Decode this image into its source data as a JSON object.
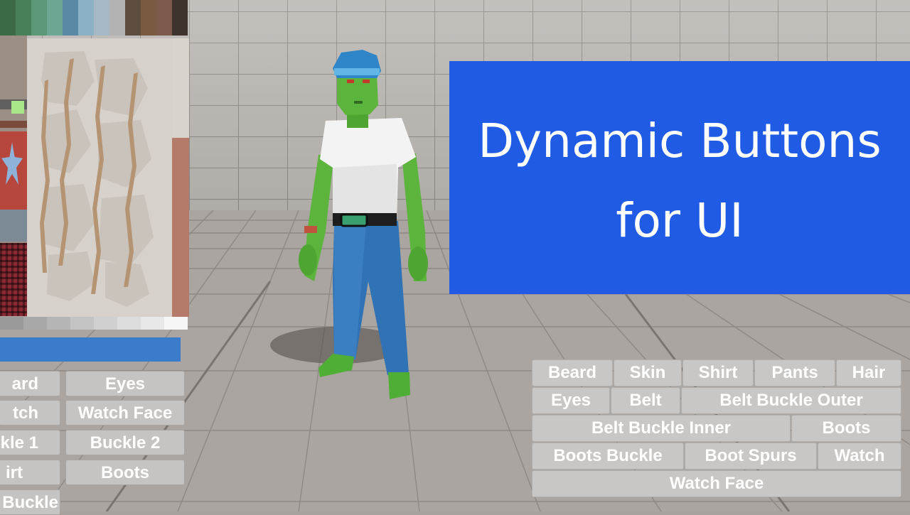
{
  "banner": {
    "line1": "Dynamic Buttons",
    "line2": "for UI"
  },
  "left_panel": {
    "button_rows": [
      {
        "left": "ard",
        "right": "Eyes"
      },
      {
        "left": "tch",
        "right": "Watch Face"
      },
      {
        "left": "kle 1",
        "right": "Buckle 2"
      },
      {
        "left": "irt",
        "right": "Boots"
      },
      {
        "left": "Buckle",
        "right": ""
      }
    ],
    "swatch_colors": [
      "#3d6a46",
      "#47805a",
      "#5a9878",
      "#6ba792",
      "#5a89a6",
      "#8ab2c4",
      "#a6b8c4",
      "#b3b3b3",
      "#5c4d3f",
      "#7a5a40",
      "#7d5a4c",
      "#3f342d"
    ],
    "gray_strip": [
      "#9a9a9a",
      "#a8a8a8",
      "#b5b5b5",
      "#c3c3c3",
      "#d0d0d0",
      "#dcdcdc",
      "#e8e8e8",
      "#f6f6f6"
    ]
  },
  "button_grid": {
    "rows": [
      [
        "Beard",
        "Skin",
        "Shirt",
        "Pants",
        "Hair"
      ],
      [
        "Eyes",
        "Belt",
        "Belt Buckle Outer"
      ],
      [
        "Belt Buckle Inner",
        "Boots"
      ],
      [
        "Boots Buckle",
        "Boot Spurs",
        "Watch"
      ],
      [
        "Watch Face"
      ]
    ]
  },
  "colors": {
    "banner_bg": "#1f5be4",
    "button_bg": "#c9c7c5",
    "progress_bar": "#3d7fd0",
    "skin": "#5cb43d",
    "shirt": "#f3f3f3",
    "pants": "#2f72b6",
    "hair": "#2e86c8"
  }
}
